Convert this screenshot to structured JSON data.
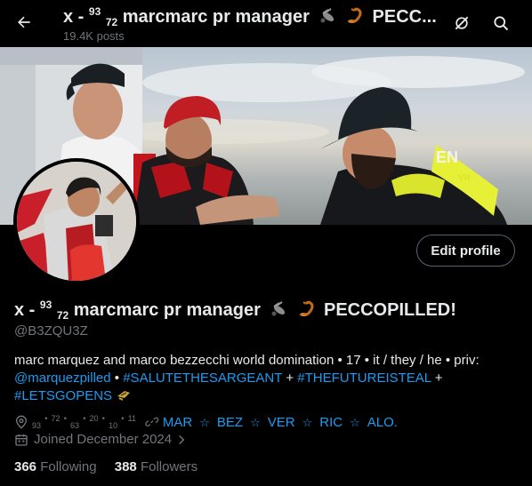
{
  "header": {
    "title_prefix": "x - ",
    "title_sup": "93",
    "title_sub": "72",
    "title_rest": " marcmarc pr manager",
    "title_end": " PECC...",
    "post_count": "19.4K posts"
  },
  "profile": {
    "name_prefix": "x - ",
    "name_sup": "93",
    "name_sub": "72",
    "name_rest": " marcmarc pr manager",
    "name_end": "PECCOPILLED!",
    "handle": "@B3ZQU3Z",
    "edit_label": "Edit profile"
  },
  "bio": {
    "line1": "marc marquez and marco bezzecchi world domination • 17 • it / they / he • priv:",
    "mention": "@marquezpilled",
    "sep1": " • ",
    "tag1": "#SALUTETHESARGEANT",
    "sep2": " + ",
    "tag2": "#THEFUTUREISTEAL",
    "sep3": " +",
    "tag3": "#LETSGOPENS"
  },
  "meta": {
    "location": {
      "n1": "93",
      "s1": "72",
      "n2": "63",
      "s2": "20",
      "n3": "10",
      "s3": "11"
    },
    "link_items": [
      "MAR",
      "BEZ",
      "VER",
      "RIC",
      "ALO."
    ],
    "joined": "Joined December 2024"
  },
  "stats": {
    "following_count": "366",
    "following_label": "Following",
    "followers_count": "388",
    "followers_label": "Followers"
  }
}
